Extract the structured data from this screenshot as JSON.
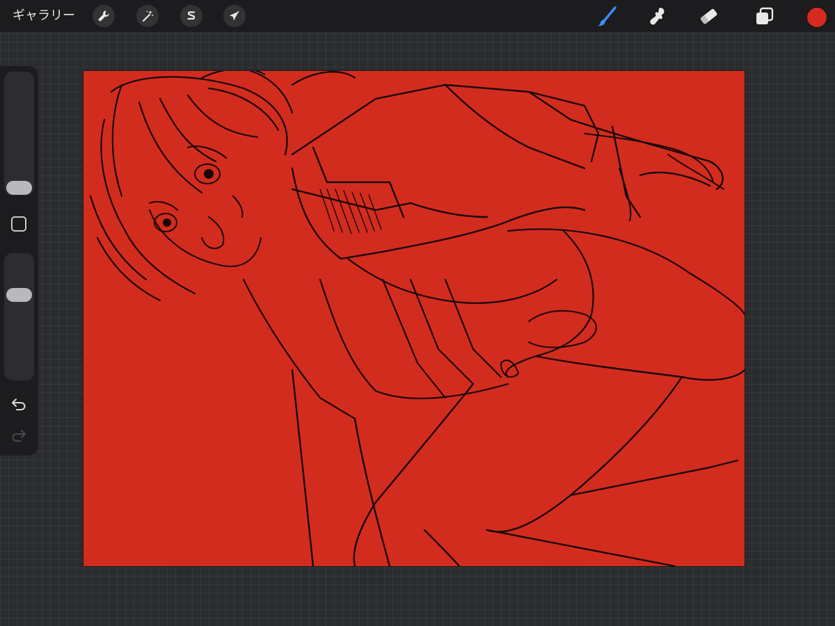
{
  "topbar": {
    "gallery_label": "ギャラリー",
    "left_tools": [
      {
        "name": "actions",
        "icon": "wrench-icon"
      },
      {
        "name": "adjustments",
        "icon": "magic-wand-icon"
      },
      {
        "name": "selection",
        "icon": "selection-s-icon"
      },
      {
        "name": "transform",
        "icon": "arrow-cursor-icon"
      }
    ],
    "right_tools": [
      {
        "name": "brush",
        "icon": "brush-icon",
        "active": true
      },
      {
        "name": "smudge",
        "icon": "smudge-icon",
        "active": false
      },
      {
        "name": "eraser",
        "icon": "eraser-icon",
        "active": false
      },
      {
        "name": "layers",
        "icon": "layers-icon",
        "active": false
      }
    ],
    "current_color": "#d42a1f"
  },
  "sidebar": {
    "brush_size_level": 0.5,
    "opacity_level": 0.65,
    "modify_icon": "square-modify-icon",
    "undo_icon": "undo-arrow-icon",
    "redo_icon": "redo-arrow-icon",
    "redo_enabled": false
  },
  "canvas": {
    "background_color": "#d22c1f",
    "sketch_color": "#1a0705",
    "content": "sketch-artwork"
  },
  "theme": {
    "accent": "#3a8dff",
    "bar_bg": "#1c1c1e",
    "workspace_bg": "#2a2b2d"
  }
}
